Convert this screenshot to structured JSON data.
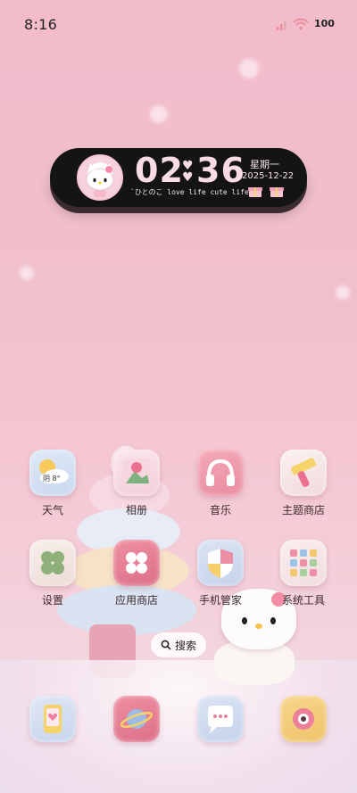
{
  "status_bar": {
    "time": "8:16",
    "battery": "100"
  },
  "clock_widget": {
    "hours": "02",
    "minutes": "36",
    "weekday": "星期一",
    "date": "2025-12-22",
    "tagline": "`ひとのこ love life cute life"
  },
  "apps": [
    {
      "label": "天气",
      "icon": "weather-icon",
      "badge": "阴 8°"
    },
    {
      "label": "相册",
      "icon": "gallery-icon"
    },
    {
      "label": "音乐",
      "icon": "headphones-icon"
    },
    {
      "label": "主题商店",
      "icon": "theme-store-icon"
    },
    {
      "label": "设置",
      "icon": "clover-settings-icon"
    },
    {
      "label": "应用商店",
      "icon": "app-store-icon"
    },
    {
      "label": "手机管家",
      "icon": "shield-icon"
    },
    {
      "label": "系统工具",
      "icon": "tools-grid-icon"
    }
  ],
  "search": {
    "label": "搜索"
  },
  "dock": [
    {
      "icon": "phone-heart-icon"
    },
    {
      "icon": "planet-browser-icon"
    },
    {
      "icon": "message-bubble-icon"
    },
    {
      "icon": "camera-icon"
    }
  ],
  "colors": {
    "widget_bg": "#141414",
    "clock_digits": "#f9dbe3",
    "background": "#f2bccb"
  }
}
